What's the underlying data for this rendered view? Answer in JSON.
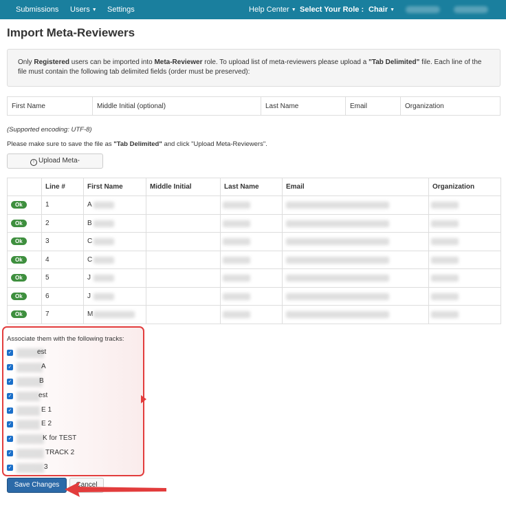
{
  "nav": {
    "left": [
      "Submissions",
      "Users",
      "Settings"
    ],
    "help_center": "Help Center",
    "select_role": "Select Your Role :",
    "role": "Chair"
  },
  "page_title": "Import Meta-Reviewers",
  "info": {
    "p1": "Only ",
    "registered": "Registered",
    "p2": " users can be imported into ",
    "role": "Meta-Reviewer",
    "p3": " role. To upload list of meta-reviewers please upload a ",
    "tab_delim": "\"Tab Delimited\"",
    "p4": " file. Each line of the file must contain the following tab delimited fields (order must be preserved):"
  },
  "fields": [
    "First Name",
    "Middle Initial (optional)",
    "Last Name",
    "Email",
    "Organization"
  ],
  "encoding_note": "(Supported encoding: UTF-8)",
  "instruction": {
    "p1": "Please make sure to save the file as ",
    "bold": "\"Tab Delimited\"",
    "p2": " and click \"Upload Meta-Reviewers\"."
  },
  "upload_button": "Upload Meta-",
  "results": {
    "headers": [
      "",
      "Line #",
      "First Name",
      "Middle Initial",
      "Last Name",
      "Email",
      "Organization"
    ],
    "rows": [
      {
        "status": "Ok",
        "line": "1",
        "first": "A"
      },
      {
        "status": "Ok",
        "line": "2",
        "first": "B"
      },
      {
        "status": "Ok",
        "line": "3",
        "first": "C"
      },
      {
        "status": "Ok",
        "line": "4",
        "first": "C"
      },
      {
        "status": "Ok",
        "line": "5",
        "first": "J"
      },
      {
        "status": "Ok",
        "line": "6",
        "first": "J"
      },
      {
        "status": "Ok",
        "line": "7",
        "first": "M"
      }
    ]
  },
  "tracks": {
    "label": "Associate them with the following tracks:",
    "items": [
      "est",
      "A",
      "B",
      "est",
      "E 1",
      "E 2",
      "K for TEST",
      "TRACK 2",
      "3"
    ]
  },
  "buttons": {
    "save": "Save Changes",
    "cancel": "Cancel"
  },
  "colors": {
    "nav_bg": "#1a7f9e",
    "save_bg": "#2c6aa8",
    "ok_badge": "#3e8f3e",
    "highlight": "#e23c3c"
  }
}
